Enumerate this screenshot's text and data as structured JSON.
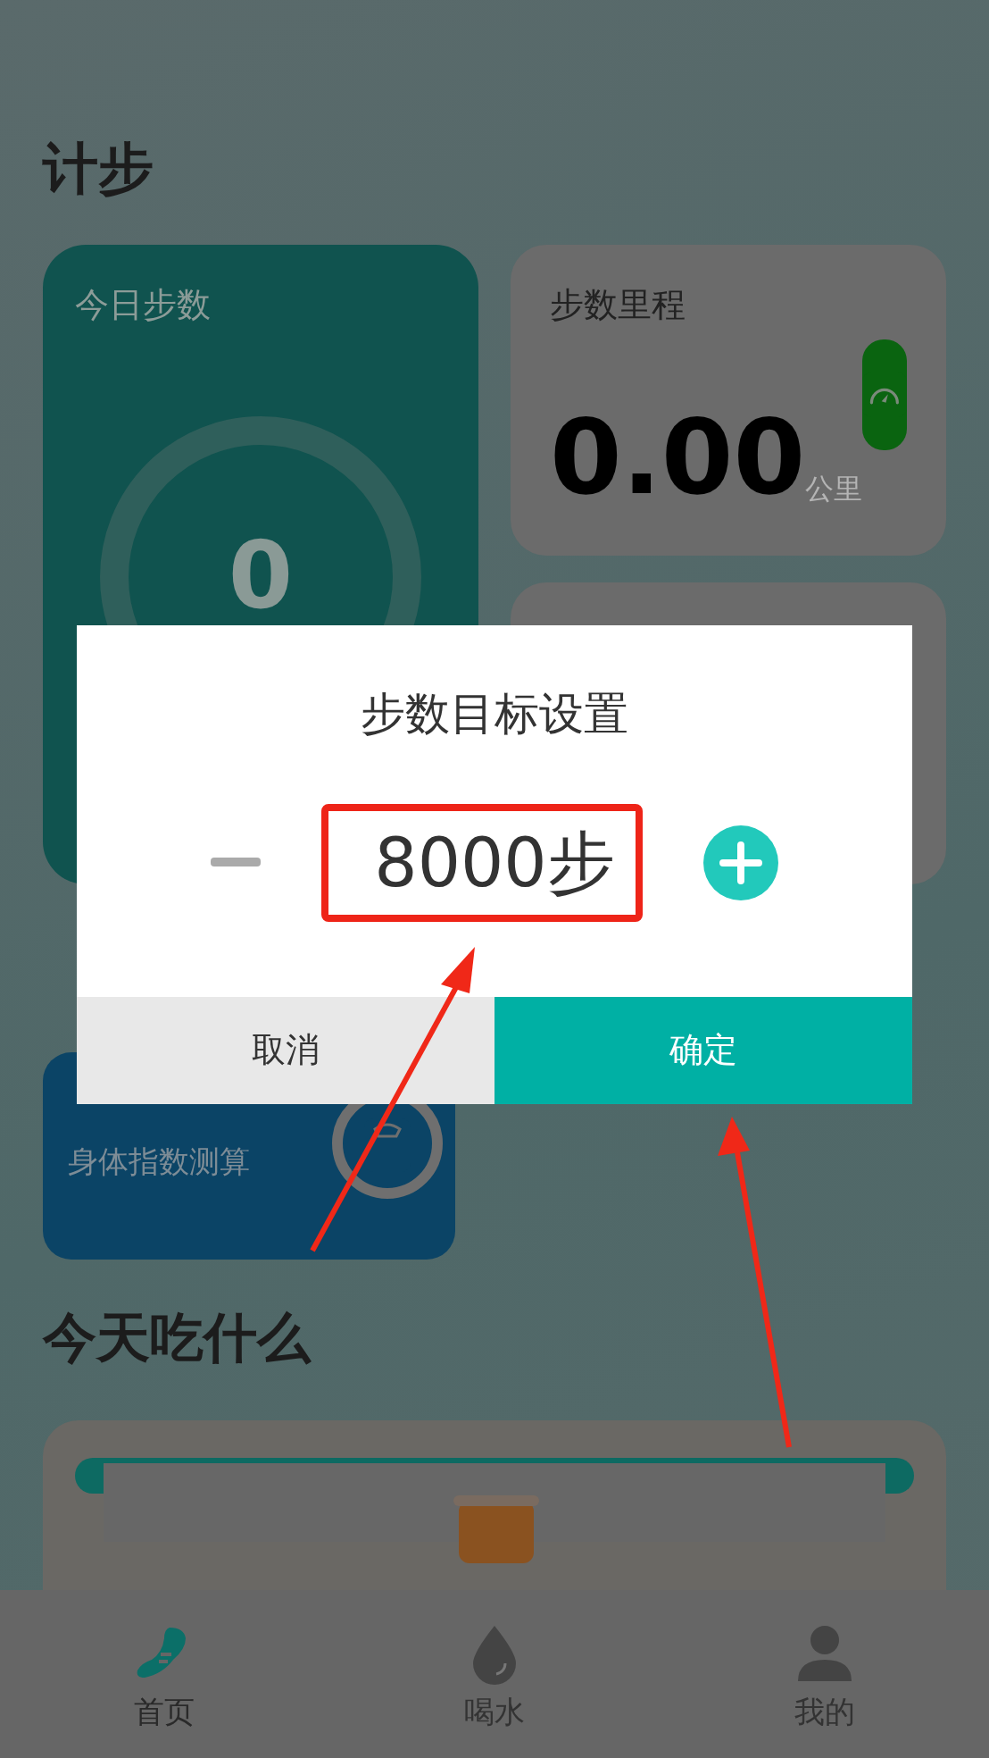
{
  "page": {
    "title": "计步"
  },
  "steps_card": {
    "title": "今日步数",
    "value": "0"
  },
  "distance_card": {
    "title": "步数里程",
    "value": "0.00",
    "unit": "公里"
  },
  "bmi_card": {
    "subtitle": "身体指数测算"
  },
  "food_section": {
    "title": "今天吃什么"
  },
  "tabs": [
    {
      "label": "首页",
      "selected": true,
      "kind": "home"
    },
    {
      "label": "喝水",
      "selected": false,
      "kind": "water"
    },
    {
      "label": "我的",
      "selected": false,
      "kind": "profile"
    }
  ],
  "dialog": {
    "title": "步数目标设置",
    "value": "8000步",
    "highlighted": true,
    "buttons": [
      {
        "label": "取消",
        "kind": "cancel"
      },
      {
        "label": "确定",
        "kind": "confirm"
      }
    ]
  }
}
